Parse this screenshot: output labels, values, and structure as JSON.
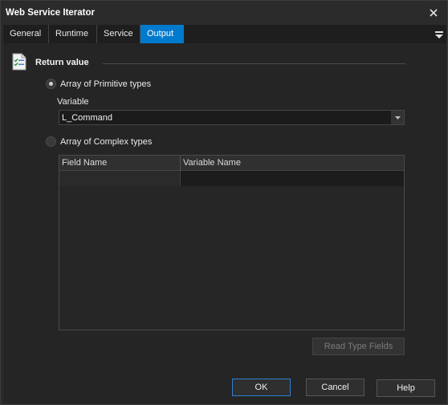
{
  "window": {
    "title": "Web Service Iterator"
  },
  "tabs": [
    {
      "label": "General",
      "active": false
    },
    {
      "label": "Runtime",
      "active": false
    },
    {
      "label": "Service",
      "active": false
    },
    {
      "label": "Output",
      "active": true
    }
  ],
  "section": {
    "title": "Return value"
  },
  "options": {
    "primitive": {
      "label": "Array of Primitive types",
      "checked": true
    },
    "complex": {
      "label": "Array of Complex types",
      "checked": false
    }
  },
  "variable": {
    "label": "Variable",
    "value": "L_Command"
  },
  "grid": {
    "columns": [
      "Field Name",
      "Variable Name"
    ],
    "rows": [
      [
        "",
        ""
      ]
    ]
  },
  "buttons": {
    "read_type_fields": "Read Type Fields",
    "ok": "OK",
    "cancel": "Cancel",
    "help": "Help"
  },
  "colors": {
    "accent": "#007acc",
    "background": "#252525"
  },
  "icons": {
    "close": "close-icon",
    "menu": "hamburger-icon",
    "section": "checklist-icon",
    "dropdown": "chevron-down-icon"
  }
}
